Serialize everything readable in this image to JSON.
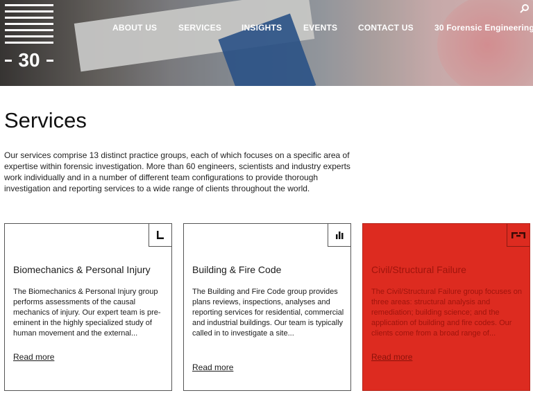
{
  "header": {
    "logo_number": "30",
    "nav": [
      {
        "label": "ABOUT US"
      },
      {
        "label": "SERVICES"
      },
      {
        "label": "INSIGHTS"
      },
      {
        "label": "EVENTS"
      },
      {
        "label": "CONTACT US"
      },
      {
        "label": "30 Forensic Engineering"
      }
    ],
    "search_icon": "search-icon"
  },
  "page": {
    "title": "Services",
    "intro": "Our services comprise 13 distinct practice groups, each of which focuses on a specific area of expertise within forensic investigation. More than 60 engineers, scientists and industry experts work individually and in a number of different team configurations to provide thorough investigation and reporting services to a wide range of clients throughout the world."
  },
  "cards": [
    {
      "title": "Biomechanics & Personal Injury",
      "description": "The Biomechanics & Personal Injury group performs assessments of the causal mechanics of injury. Our expert team is pre-eminent in the highly specialized study of human movement and the external...",
      "link": "Read more",
      "icon": "biomechanics-icon"
    },
    {
      "title": "Building & Fire Code",
      "description": "The Building and Fire Code group provides plans reviews, inspections, analyses and reporting services for residential, commercial and industrial buildings. Our team is typically called in to investigate a site...",
      "link": "Read more",
      "icon": "bar-chart-icon"
    },
    {
      "title": "Civil/Structural Failure",
      "description": "The Civil/Structural Failure group focuses on three areas: structural analysis and remediation; building science; and the application of building and fire codes. Our clients come from a broad range of...",
      "link": "Read more",
      "icon": "structure-icon",
      "accent": "#dd2b20"
    }
  ]
}
